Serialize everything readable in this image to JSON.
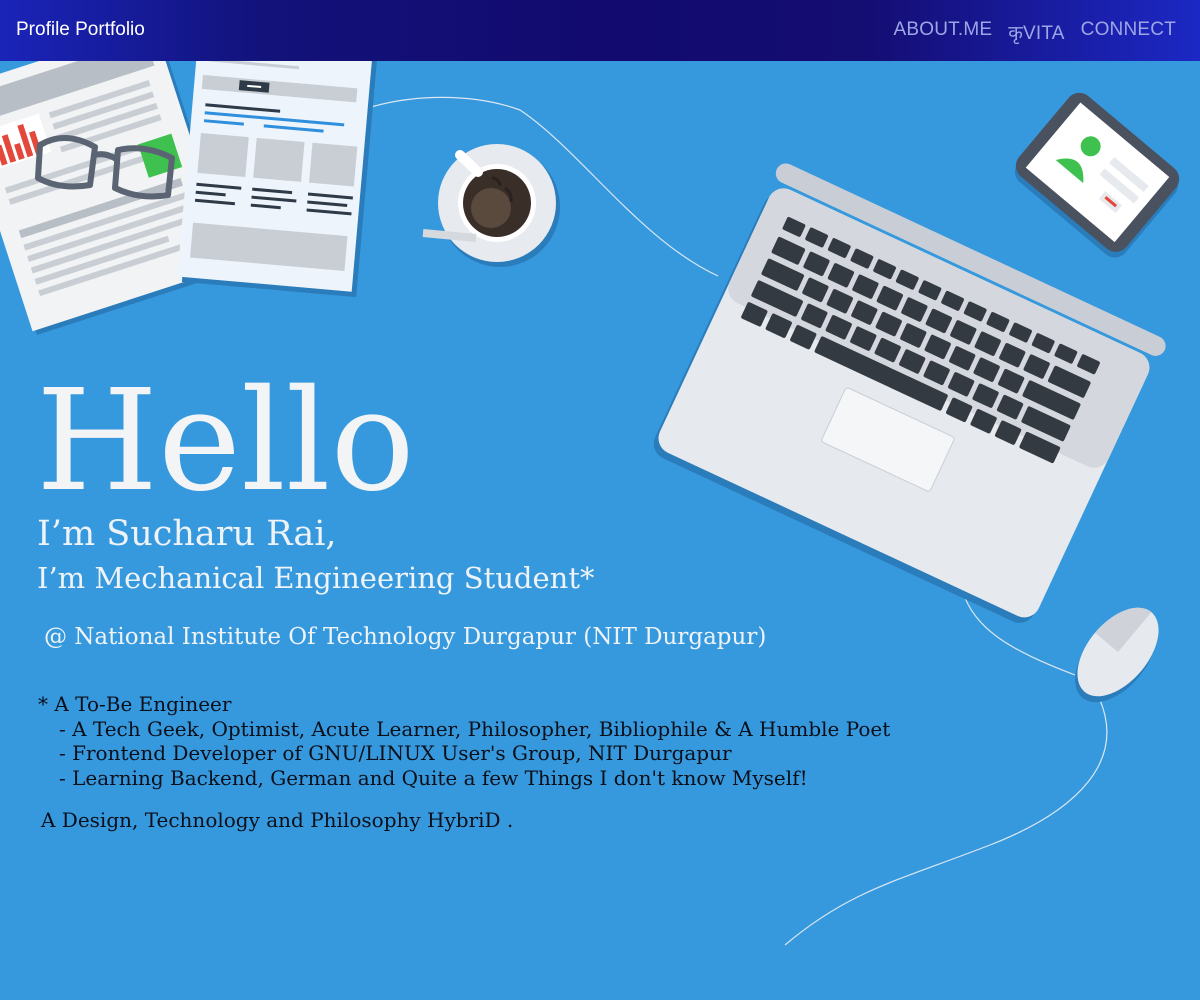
{
  "header": {
    "brand": "Profile Portfolio",
    "nav": [
      {
        "label": "ABOUT.ME"
      },
      {
        "label": "कृVITA"
      },
      {
        "label": "CONNECT"
      }
    ]
  },
  "hero": {
    "greeting": "Hello",
    "name_line": "I’m Sucharu Rai,",
    "role_line": "I’m Mechanical Engineering Student*",
    "institute_line": "@ National Institute Of Technology Durgapur (NIT Durgapur)",
    "footnote_title": "* A To-Be Engineer",
    "points": [
      "- A Tech Geek, Optimist, Acute Learner, Philosopher, Bibliophile & A Humble Poet",
      "- Frontend Developer of GNU/LINUX User's Group, NIT Durgapur",
      "- Learning Backend, German and Quite a few Things I don't know Myself!"
    ],
    "tagline": "A Design, Technology and Philosophy HybriD ."
  },
  "colors": {
    "background": "#3799dd",
    "navbar_dark": "#120a6e",
    "navbar_edge": "#1a24b8",
    "nav_link": "#9da6e6",
    "hero_text": "#f2f4f6"
  },
  "illustration": {
    "items": [
      "newspaper-icon",
      "glasses-icon",
      "coffee-cup-icon",
      "laptop-icon",
      "smartphone-icon",
      "mouse-icon"
    ]
  }
}
